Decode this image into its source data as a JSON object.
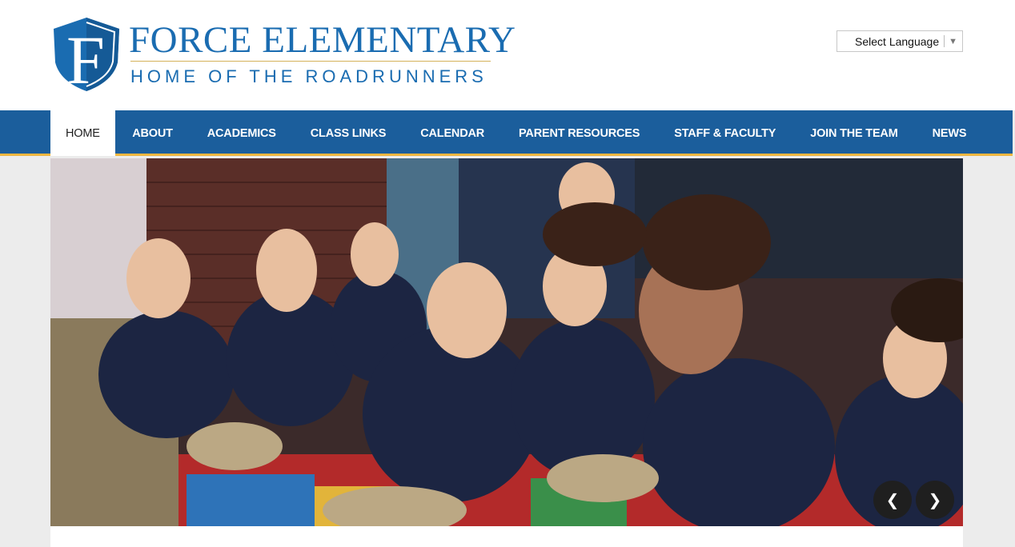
{
  "site": {
    "name": "FORCE ELEMENTARY",
    "tagline": "HOME OF THE ROADRUNNERS",
    "logo_letter": "F"
  },
  "language": {
    "label": "Select Language",
    "icon": "dropdown-arrow-icon"
  },
  "nav": {
    "items": [
      {
        "label": "HOME",
        "active": true
      },
      {
        "label": "ABOUT"
      },
      {
        "label": "ACADEMICS"
      },
      {
        "label": "CLASS LINKS"
      },
      {
        "label": "CALENDAR"
      },
      {
        "label": "PARENT RESOURCES"
      },
      {
        "label": "STAFF & FACULTY"
      },
      {
        "label": "JOIN THE TEAM"
      },
      {
        "label": "NEWS"
      }
    ]
  },
  "slider": {
    "prev_icon": "chevron-left-icon",
    "next_icon": "chevron-right-icon",
    "prev_glyph": "❮",
    "next_glyph": "❯"
  },
  "colors": {
    "brand_blue": "#1a6cb1",
    "nav_blue": "#1b5e9c",
    "accent_gold": "#f0b640"
  }
}
